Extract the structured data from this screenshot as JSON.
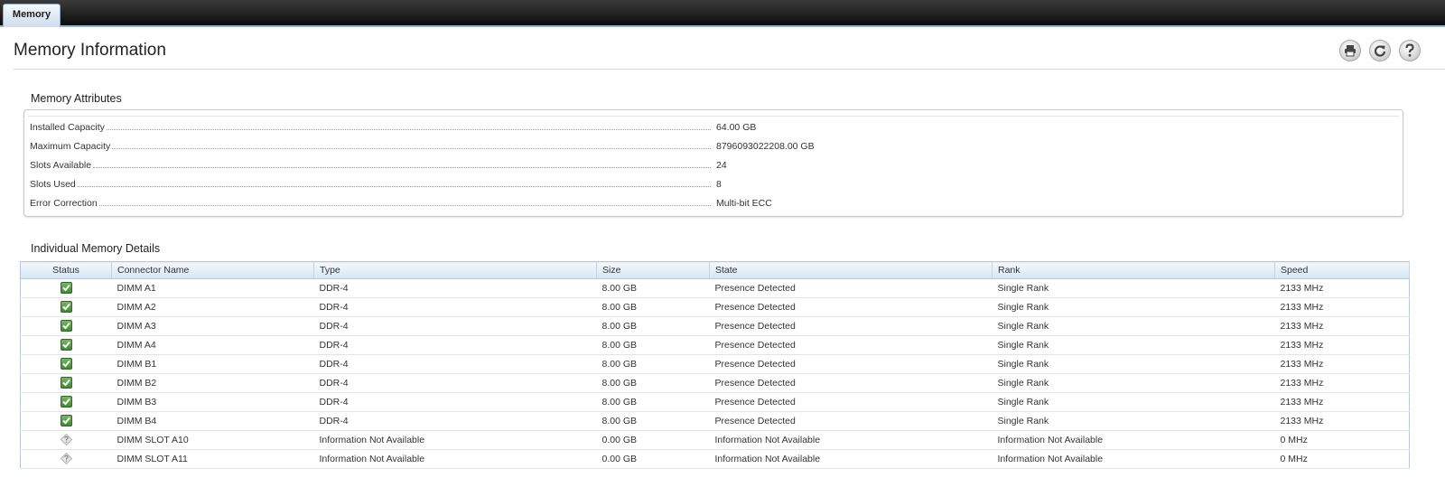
{
  "tabs": [
    {
      "label": "Memory"
    }
  ],
  "header": {
    "title": "Memory Information"
  },
  "toolbar": {
    "print_icon": "print-icon",
    "refresh_icon": "refresh-icon",
    "help_icon": "help-icon"
  },
  "attributes": {
    "title": "Memory Attributes",
    "rows": [
      {
        "label": "Installed Capacity",
        "value": "64.00 GB"
      },
      {
        "label": "Maximum Capacity",
        "value": "8796093022208.00 GB"
      },
      {
        "label": "Slots Available",
        "value": "24"
      },
      {
        "label": "Slots Used",
        "value": "8"
      },
      {
        "label": "Error Correction",
        "value": "Multi-bit ECC"
      }
    ]
  },
  "details": {
    "title": "Individual Memory Details",
    "columns": [
      "Status",
      "Connector Name",
      "Type",
      "Size",
      "State",
      "Rank",
      "Speed"
    ],
    "rows": [
      {
        "status": "ok",
        "connector": "DIMM A1",
        "type": "DDR-4",
        "size": "8.00 GB",
        "state": "Presence Detected",
        "rank": "Single Rank",
        "speed": "2133 MHz"
      },
      {
        "status": "ok",
        "connector": "DIMM A2",
        "type": "DDR-4",
        "size": "8.00 GB",
        "state": "Presence Detected",
        "rank": "Single Rank",
        "speed": "2133 MHz"
      },
      {
        "status": "ok",
        "connector": "DIMM A3",
        "type": "DDR-4",
        "size": "8.00 GB",
        "state": "Presence Detected",
        "rank": "Single Rank",
        "speed": "2133 MHz"
      },
      {
        "status": "ok",
        "connector": "DIMM A4",
        "type": "DDR-4",
        "size": "8.00 GB",
        "state": "Presence Detected",
        "rank": "Single Rank",
        "speed": "2133 MHz"
      },
      {
        "status": "ok",
        "connector": "DIMM B1",
        "type": "DDR-4",
        "size": "8.00 GB",
        "state": "Presence Detected",
        "rank": "Single Rank",
        "speed": "2133 MHz"
      },
      {
        "status": "ok",
        "connector": "DIMM B2",
        "type": "DDR-4",
        "size": "8.00 GB",
        "state": "Presence Detected",
        "rank": "Single Rank",
        "speed": "2133 MHz"
      },
      {
        "status": "ok",
        "connector": "DIMM B3",
        "type": "DDR-4",
        "size": "8.00 GB",
        "state": "Presence Detected",
        "rank": "Single Rank",
        "speed": "2133 MHz"
      },
      {
        "status": "ok",
        "connector": "DIMM B4",
        "type": "DDR-4",
        "size": "8.00 GB",
        "state": "Presence Detected",
        "rank": "Single Rank",
        "speed": "2133 MHz"
      },
      {
        "status": "unknown",
        "connector": "DIMM SLOT A10",
        "type": "Information Not Available",
        "size": "0.00 GB",
        "state": "Information Not Available",
        "rank": "Information Not Available",
        "speed": "0 MHz"
      },
      {
        "status": "unknown",
        "connector": "DIMM SLOT A11",
        "type": "Information Not Available",
        "size": "0.00 GB",
        "state": "Information Not Available",
        "rank": "Information Not Available",
        "speed": "0 MHz"
      }
    ]
  },
  "colors": {
    "tabbar": "#0d0d0d",
    "tab_active": "#cddcec",
    "table_header": "#d7e5f3",
    "status_ok": "#3f8a33",
    "status_unknown": "#b5b5b5"
  }
}
